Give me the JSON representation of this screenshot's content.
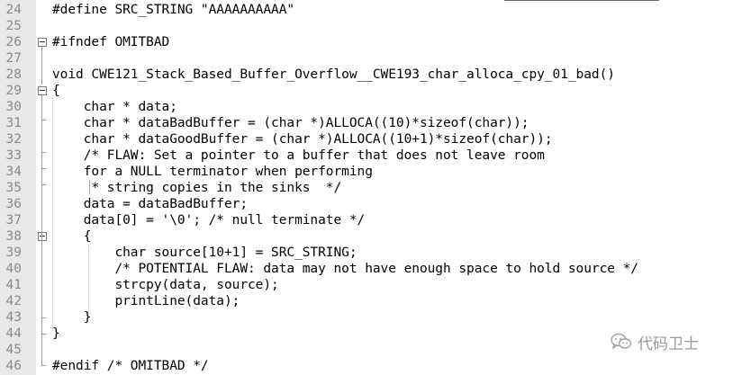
{
  "editor": {
    "lines": [
      {
        "num": "24",
        "code": "#define SRC_STRING \"AAAAAAAAAA\""
      },
      {
        "num": "25",
        "code": ""
      },
      {
        "num": "26",
        "code": "#ifndef OMITBAD"
      },
      {
        "num": "27",
        "code": ""
      },
      {
        "num": "28",
        "code": "void CWE121_Stack_Based_Buffer_Overflow__CWE193_char_alloca_cpy_01_bad()"
      },
      {
        "num": "29",
        "code": "{"
      },
      {
        "num": "30",
        "code": "    char * data;"
      },
      {
        "num": "31",
        "code": "    char * dataBadBuffer = (char *)ALLOCA((10)*sizeof(char));"
      },
      {
        "num": "32",
        "code": "    char * dataGoodBuffer = (char *)ALLOCA((10+1)*sizeof(char));"
      },
      {
        "num": "33",
        "code": "    /* FLAW: Set a pointer to a buffer that does not leave room"
      },
      {
        "num": "34",
        "code": "    for a NULL terminator when performing"
      },
      {
        "num": "35",
        "code": "     * string copies in the sinks  */"
      },
      {
        "num": "36",
        "code": "    data = dataBadBuffer;"
      },
      {
        "num": "37",
        "code": "    data[0] = '\\0'; /* null terminate */"
      },
      {
        "num": "38",
        "code": "    {"
      },
      {
        "num": "39",
        "code": "        char source[10+1] = SRC_STRING;"
      },
      {
        "num": "40",
        "code": "        /* POTENTIAL FLAW: data may not have enough space to hold source */"
      },
      {
        "num": "41",
        "code": "        strcpy(data, source);"
      },
      {
        "num": "42",
        "code": "        printLine(data);"
      },
      {
        "num": "43",
        "code": "    }"
      },
      {
        "num": "44",
        "code": "}"
      },
      {
        "num": "45",
        "code": ""
      },
      {
        "num": "46",
        "code": "#endif /* OMITBAD */"
      }
    ]
  },
  "watermark": {
    "text": "代码卫士",
    "icon": "wechat-icon"
  },
  "colors": {
    "gutter_bg": "#e8e8e8",
    "line_number": "#8a8a8a",
    "code_text": "#000000"
  }
}
